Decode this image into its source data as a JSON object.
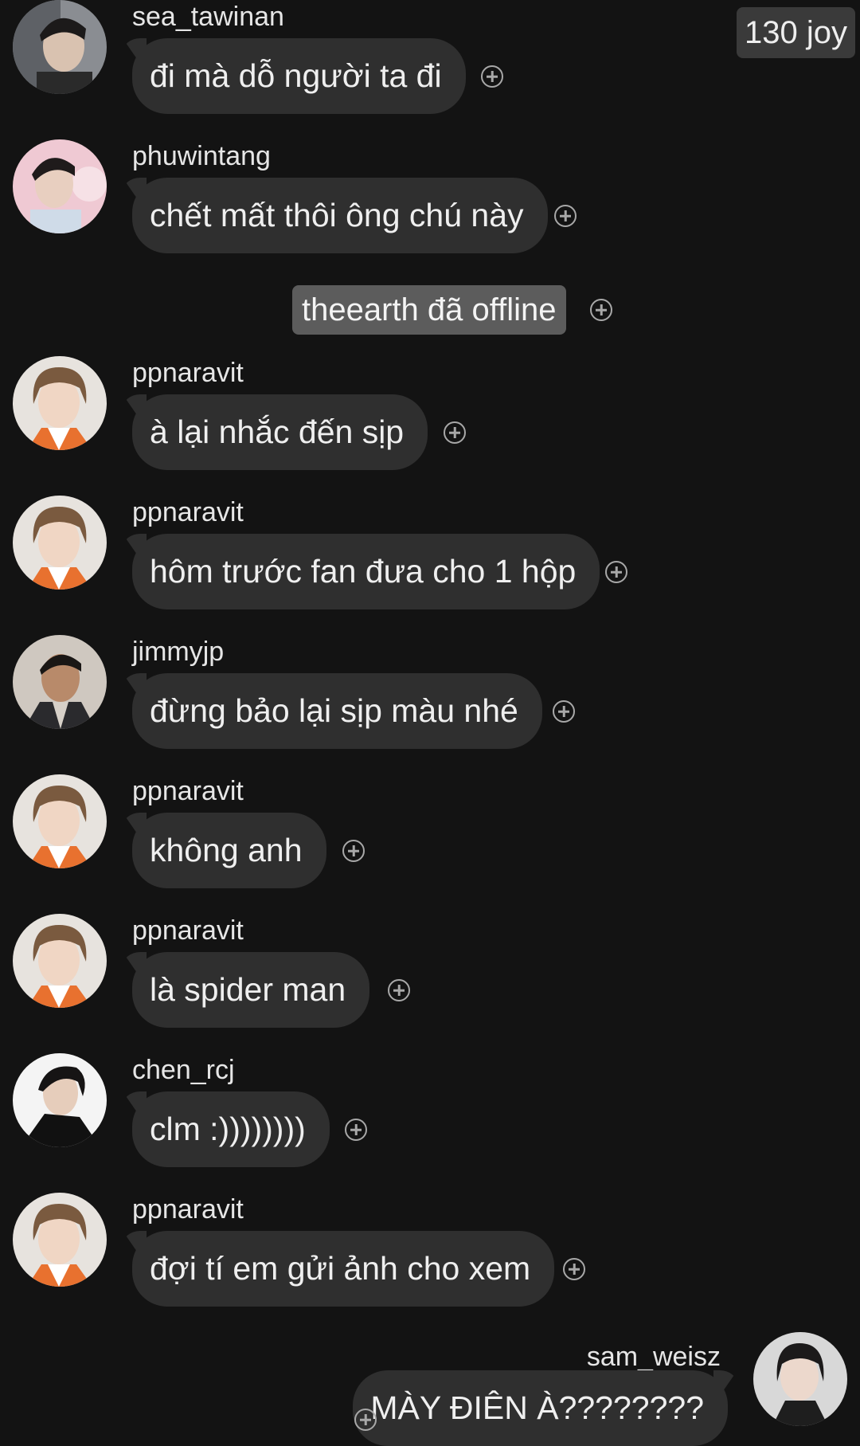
{
  "header": {
    "badge": "130 joy"
  },
  "messages": [
    {
      "username": "sea_tawinan",
      "text": "đi mà dỗ người ta đi"
    },
    {
      "username": "phuwintang",
      "text": "chết mất thôi ông chú này"
    },
    {
      "username": "ppnaravit",
      "text": "à lại nhắc đến sịp"
    },
    {
      "username": "ppnaravit",
      "text": "hôm trước fan đưa cho 1 hộp"
    },
    {
      "username": "jimmyjp",
      "text": "đừng bảo lại sịp màu nhé"
    },
    {
      "username": "ppnaravit",
      "text": "không anh"
    },
    {
      "username": "ppnaravit",
      "text": "là spider man"
    },
    {
      "username": "chen_rcj",
      "text": "clm :))))))))"
    },
    {
      "username": "ppnaravit",
      "text": "đợi tí em gửi ảnh cho xem"
    }
  ],
  "system_message": "theearth đã offline",
  "own_message": {
    "username": "sam_weisz",
    "text": "MÀY ĐIÊN À????????"
  },
  "icons": {
    "reaction": "add-reaction-icon"
  },
  "colors": {
    "background": "#131313",
    "bubble": "#2f2f2f",
    "system": "#5c5c5c",
    "badge": "#3a3a3a"
  }
}
